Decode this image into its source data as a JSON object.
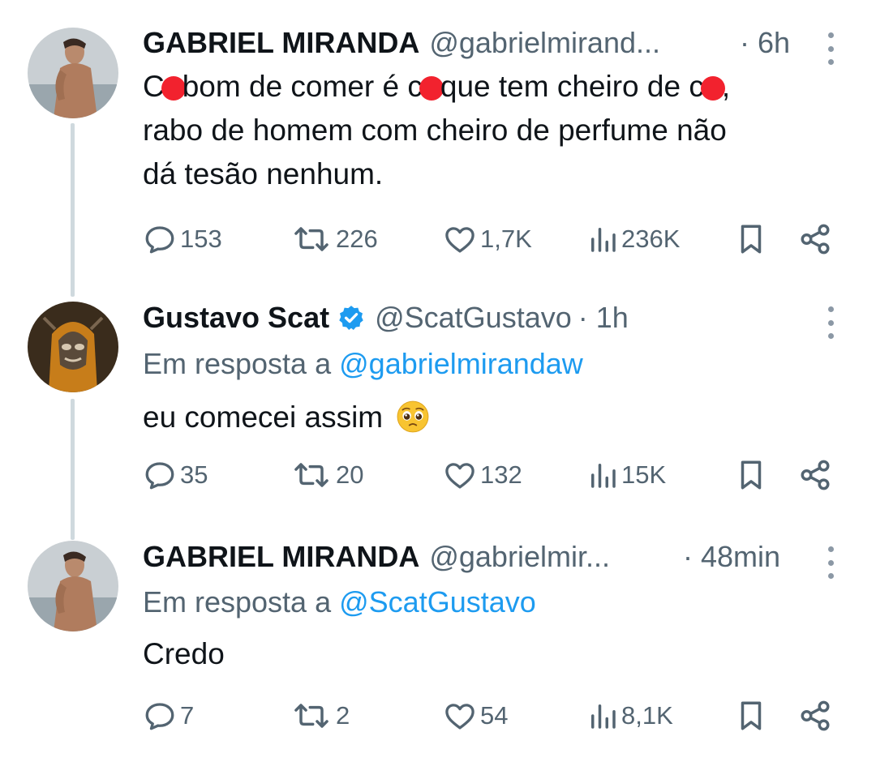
{
  "tweets": [
    {
      "name": "GABRIEL MIRANDA",
      "handle": "@gabrielmirand...",
      "time": "· 6h",
      "text": {
        "line1_a": "C",
        "line1_b": "bom de comer é c",
        "line1_c": "que tem cheiro de c",
        "line1_d": ",",
        "line2": "rabo de homem com cheiro de perfume não",
        "line3": "dá tesão nenhum."
      },
      "stats": {
        "replies": "153",
        "retweets": "226",
        "likes": "1,7K",
        "views": "236K"
      }
    },
    {
      "name": "Gustavo Scat",
      "handle": "@ScatGustavo",
      "time": "· 1h",
      "verified": true,
      "reply_prefix": "Em resposta a",
      "reply_mention": "@gabrielmirandaw",
      "text": "eu comecei assim",
      "emoji": "pleading-face",
      "stats": {
        "replies": "35",
        "retweets": "20",
        "likes": "132",
        "views": "15K"
      }
    },
    {
      "name": "GABRIEL MIRANDA",
      "handle": "@gabrielmir...",
      "time": "· 48min",
      "reply_prefix": "Em resposta a",
      "reply_mention": "@ScatGustavo",
      "text": "Credo",
      "stats": {
        "replies": "7",
        "retweets": "2",
        "likes": "54",
        "views": "8,1K"
      }
    }
  ],
  "colors": {
    "text": "#0f1419",
    "secondary": "#536471",
    "link": "#1d9bf0",
    "thread_line": "#cfd9de",
    "redaction": "#f2222e"
  }
}
